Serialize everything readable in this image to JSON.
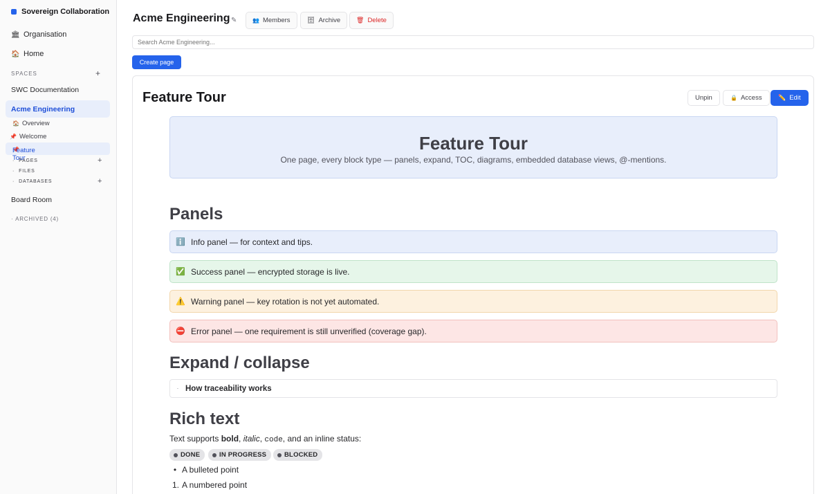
{
  "sidebar": {
    "brand": "Sovereign Collaboration",
    "organisation": "Organisation",
    "home": "Home",
    "spaces_heading": "SPACES",
    "spaces": [
      "SWC Documentation",
      "Acme Engineering",
      "Board Room"
    ],
    "active_space": "Acme Engineering",
    "space_children": {
      "overview": "Overview",
      "welcome": "Welcome",
      "feature_tour": "Feature Tour"
    },
    "tree_sections": [
      "PAGES",
      "FILES",
      "DATABASES"
    ],
    "archived": "ARCHIVED (4)"
  },
  "topbar": {
    "title": "Acme Engineering",
    "members": "Members",
    "archive": "Archive",
    "delete": "Delete"
  },
  "search": {
    "placeholder": "Search Acme Engineering..."
  },
  "create_page": "Create page",
  "page": {
    "title": "Feature Tour",
    "unpin": "Unpin",
    "access": "Access",
    "edit": "Edit",
    "hero_title": "Feature Tour",
    "hero_subtitle": "One page, every block type — panels, expand, TOC, diagrams, embedded database views, @-mentions.",
    "panels_heading": "Panels",
    "panels": [
      {
        "type": "info",
        "icon": "ℹ️",
        "text": "Info panel — for context and tips."
      },
      {
        "type": "success",
        "icon": "✅",
        "text": "Success panel — encrypted storage is live."
      },
      {
        "type": "warning",
        "icon": "⚠️",
        "text": "Warning panel — key rotation is not yet automated."
      },
      {
        "type": "error",
        "icon": "⛔",
        "text": "Error panel — one requirement is still unverified (coverage gap)."
      }
    ],
    "expand_heading": "Expand / collapse",
    "expand_item": "How traceability works",
    "rich_heading": "Rich text",
    "rich": {
      "prefix": "Text supports ",
      "bold": "bold",
      "sep1": ", ",
      "italic": "italic",
      "sep2": ", ",
      "code": "code",
      "suffix": ", and an inline status:"
    },
    "statuses": [
      "DONE",
      "IN PROGRESS",
      "BLOCKED"
    ],
    "bullet_item": "A bulleted point",
    "numbered_marker": "1.",
    "numbered_item": "A numbered point"
  },
  "colors": {
    "accent": "#2563eb",
    "info_bg": "#e8eefb",
    "success_bg": "#e6f6ea",
    "warning_bg": "#fdf1df",
    "error_bg": "#fde6e5"
  }
}
